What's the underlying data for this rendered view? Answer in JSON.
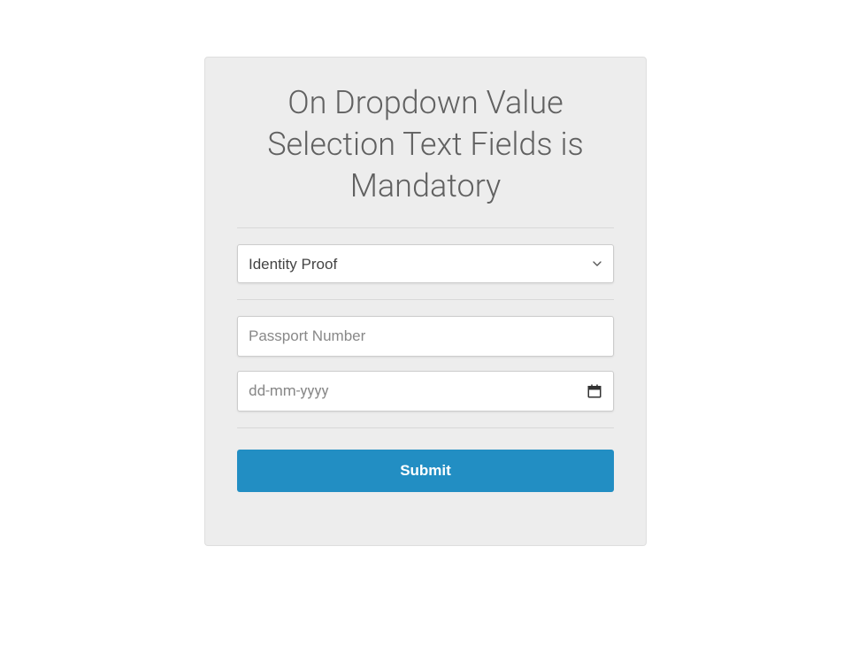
{
  "form": {
    "title": "On Dropdown Value Selection Text Fields is Mandatory",
    "identity_proof": {
      "selected": "Identity Proof"
    },
    "passport": {
      "placeholder": "Passport Number",
      "value": ""
    },
    "date": {
      "placeholder": "dd-mm-yyyy",
      "value": ""
    },
    "submit_label": "Submit"
  }
}
